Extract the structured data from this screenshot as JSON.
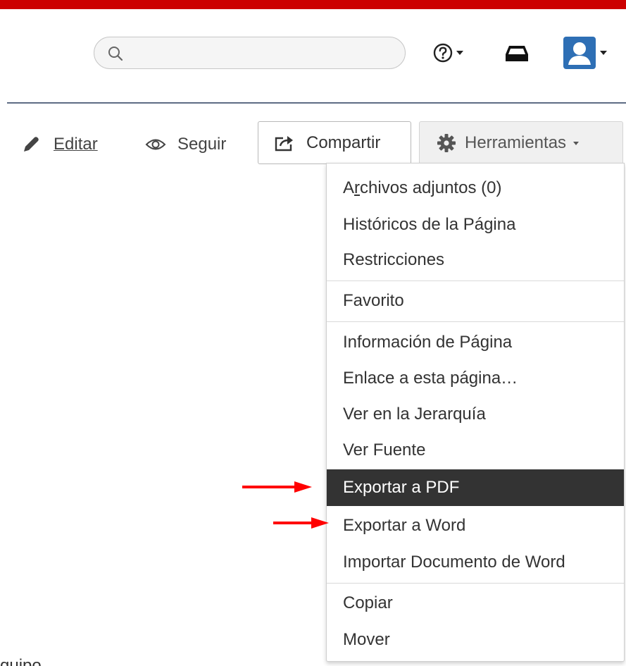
{
  "header": {
    "search": {
      "value": "",
      "placeholder": ""
    }
  },
  "page_actions": {
    "edit_label": "Editar",
    "follow_label": "Seguir",
    "share_label": "Compartir",
    "tools_label": "Herramientas"
  },
  "tools_menu": {
    "items": [
      {
        "label_pre": "A",
        "label_ul": "r",
        "label_post": "chivos adjuntos (0)"
      },
      {
        "label": "Históricos de la Página"
      },
      {
        "label": "Restricciones"
      },
      {
        "label": "Favorito"
      },
      {
        "label": "Información de Página"
      },
      {
        "label": "Enlace a esta página…"
      },
      {
        "label": "Ver en la Jerarquía"
      },
      {
        "label": "Ver Fuente"
      },
      {
        "label": "Exportar a PDF"
      },
      {
        "label": "Exportar a Word"
      },
      {
        "label": "Importar Documento de Word"
      },
      {
        "label": "Copiar"
      },
      {
        "label": "Mover"
      }
    ],
    "highlighted_item": "Exportar a PDF"
  },
  "body_fragment": "quipo",
  "colors": {
    "top_bar": "#cc0000",
    "avatar": "#2e6fb5",
    "menu_highlight": "#333333",
    "annotation_arrow": "#ff0000"
  },
  "icons": [
    "search-icon",
    "help-icon",
    "inbox-icon",
    "user-avatar-icon",
    "pencil-icon",
    "eye-icon",
    "share-icon",
    "gear-icon"
  ]
}
